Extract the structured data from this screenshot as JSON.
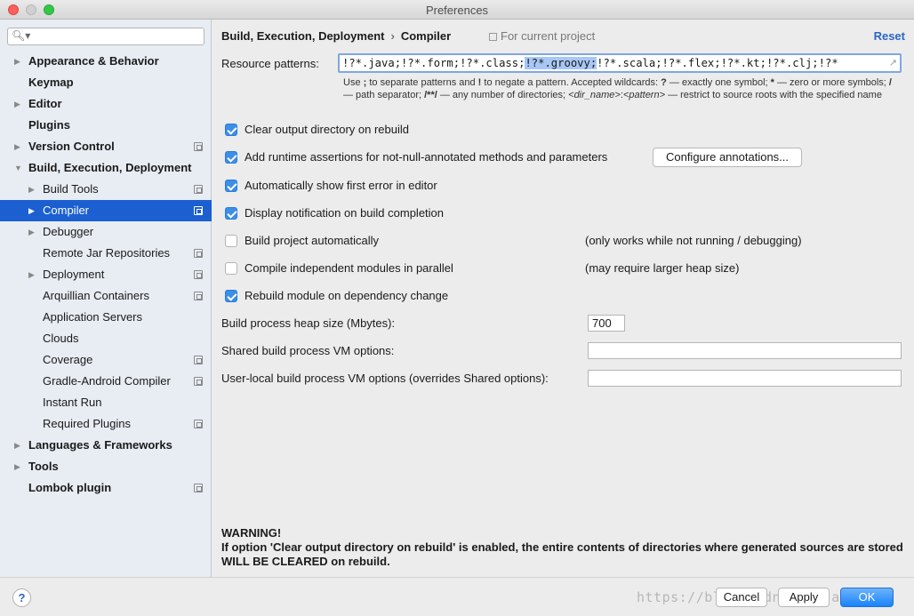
{
  "window": {
    "title": "Preferences"
  },
  "search": {
    "icon": "search-icon",
    "value": ""
  },
  "sidebar": {
    "items": [
      {
        "label": "Appearance & Behavior",
        "level": 0,
        "bold": true,
        "arrow": "collapsed",
        "project": false,
        "selected": false
      },
      {
        "label": "Keymap",
        "level": 0,
        "bold": true,
        "arrow": "none",
        "project": false,
        "selected": false
      },
      {
        "label": "Editor",
        "level": 0,
        "bold": true,
        "arrow": "collapsed",
        "project": false,
        "selected": false
      },
      {
        "label": "Plugins",
        "level": 0,
        "bold": true,
        "arrow": "none",
        "project": false,
        "selected": false
      },
      {
        "label": "Version Control",
        "level": 0,
        "bold": true,
        "arrow": "collapsed",
        "project": true,
        "selected": false
      },
      {
        "label": "Build, Execution, Deployment",
        "level": 0,
        "bold": true,
        "arrow": "expanded",
        "project": false,
        "selected": false
      },
      {
        "label": "Build Tools",
        "level": 1,
        "bold": false,
        "arrow": "collapsed",
        "project": true,
        "selected": false
      },
      {
        "label": "Compiler",
        "level": 1,
        "bold": false,
        "arrow": "collapsed",
        "project": true,
        "selected": true
      },
      {
        "label": "Debugger",
        "level": 1,
        "bold": false,
        "arrow": "collapsed",
        "project": false,
        "selected": false
      },
      {
        "label": "Remote Jar Repositories",
        "level": 1,
        "bold": false,
        "arrow": "none",
        "project": true,
        "selected": false
      },
      {
        "label": "Deployment",
        "level": 1,
        "bold": false,
        "arrow": "collapsed",
        "project": true,
        "selected": false
      },
      {
        "label": "Arquillian Containers",
        "level": 1,
        "bold": false,
        "arrow": "none",
        "project": true,
        "selected": false
      },
      {
        "label": "Application Servers",
        "level": 1,
        "bold": false,
        "arrow": "none",
        "project": false,
        "selected": false
      },
      {
        "label": "Clouds",
        "level": 1,
        "bold": false,
        "arrow": "none",
        "project": false,
        "selected": false
      },
      {
        "label": "Coverage",
        "level": 1,
        "bold": false,
        "arrow": "none",
        "project": true,
        "selected": false
      },
      {
        "label": "Gradle-Android Compiler",
        "level": 1,
        "bold": false,
        "arrow": "none",
        "project": true,
        "selected": false
      },
      {
        "label": "Instant Run",
        "level": 1,
        "bold": false,
        "arrow": "none",
        "project": false,
        "selected": false
      },
      {
        "label": "Required Plugins",
        "level": 1,
        "bold": false,
        "arrow": "none",
        "project": true,
        "selected": false
      },
      {
        "label": "Languages & Frameworks",
        "level": 0,
        "bold": true,
        "arrow": "collapsed",
        "project": false,
        "selected": false
      },
      {
        "label": "Tools",
        "level": 0,
        "bold": true,
        "arrow": "collapsed",
        "project": false,
        "selected": false
      },
      {
        "label": "Lombok plugin",
        "level": 0,
        "bold": true,
        "arrow": "none",
        "project": true,
        "selected": false
      }
    ]
  },
  "header": {
    "crumb_parent": "Build, Execution, Deployment",
    "crumb_sep": "›",
    "crumb_current": "Compiler",
    "scope": "For current project",
    "reset": "Reset"
  },
  "resource": {
    "label": "Resource patterns:",
    "value_before": "!?*.java;!?*.form;!?*.class;",
    "value_selected": "!?*.groovy;",
    "value_after": "!?*.scala;!?*.flex;!?*.kt;!?*.clj;!?*",
    "hint_1": "Use ",
    "hint_semicolon": ";",
    "hint_2": " to separate patterns and ",
    "hint_bang": "!",
    "hint_3": " to negate a pattern. Accepted wildcards: ",
    "hint_q": "?",
    "hint_4": " — exactly one symbol; ",
    "hint_star": "*",
    "hint_5": " — zero or more symbols; ",
    "hint_slash": "/",
    "hint_6": " — path separator; ",
    "hint_dstar": "/**/",
    "hint_7": " — any number of directories; ",
    "hint_dir": "<dir_name>",
    "hint_colon": ":",
    "hint_pattern": "<pattern>",
    "hint_8": " — restrict to source roots with the specified name"
  },
  "options": [
    {
      "label": "Clear output directory on rebuild",
      "checked": true
    },
    {
      "label": "Add runtime assertions for not-null-annotated methods and parameters",
      "checked": true
    },
    {
      "label": "Automatically show first error in editor",
      "checked": true
    },
    {
      "label": "Display notification on build completion",
      "checked": true
    },
    {
      "label": "Build project automatically",
      "checked": false
    },
    {
      "label": "Compile independent modules in parallel",
      "checked": false
    },
    {
      "label": "Rebuild module on dependency change",
      "checked": true
    }
  ],
  "configure_annotations": "Configure annotations...",
  "notes": {
    "build_auto": "(only works while not running / debugging)",
    "parallel": "(may require larger heap size)"
  },
  "heap": {
    "label": "Build process heap size (Mbytes):",
    "value": "700"
  },
  "shared_vm": {
    "label": "Shared build process VM options:",
    "value": ""
  },
  "user_vm": {
    "label": "User-local build process VM options (overrides Shared options):",
    "value": ""
  },
  "warning": {
    "title": "WARNING!",
    "body": "If option 'Clear output directory on rebuild' is enabled, the entire contents of directories where generated sources are stored WILL BE CLEARED on rebuild."
  },
  "footer": {
    "help": "?",
    "cancel": "Cancel",
    "apply": "Apply",
    "ok": "OK",
    "watermark": "https://blog.csdn.net/javayes"
  }
}
